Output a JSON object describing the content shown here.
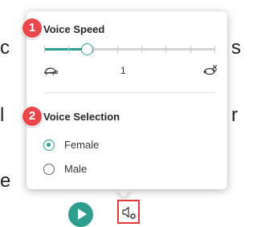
{
  "background_fragments": [
    "c",
    "s",
    "l",
    "r",
    "e"
  ],
  "popup": {
    "voice_speed": {
      "step_badge": "1",
      "title": "Voice Speed",
      "slow_icon": "turtle-icon",
      "fast_icon": "rabbit-icon",
      "value": "1",
      "slider_position": 0.25,
      "tick_count": 8
    },
    "voice_selection": {
      "step_badge": "2",
      "title": "Voice Selection",
      "options": [
        {
          "label": "Female",
          "selected": true
        },
        {
          "label": "Male",
          "selected": false
        }
      ]
    }
  },
  "toolbar": {
    "play_icon": "play-icon",
    "settings_icon": "voice-settings-icon"
  },
  "colors": {
    "accent": "#2e9e8f",
    "badge": "#e8474b",
    "highlight_border": "#e23a3a"
  }
}
